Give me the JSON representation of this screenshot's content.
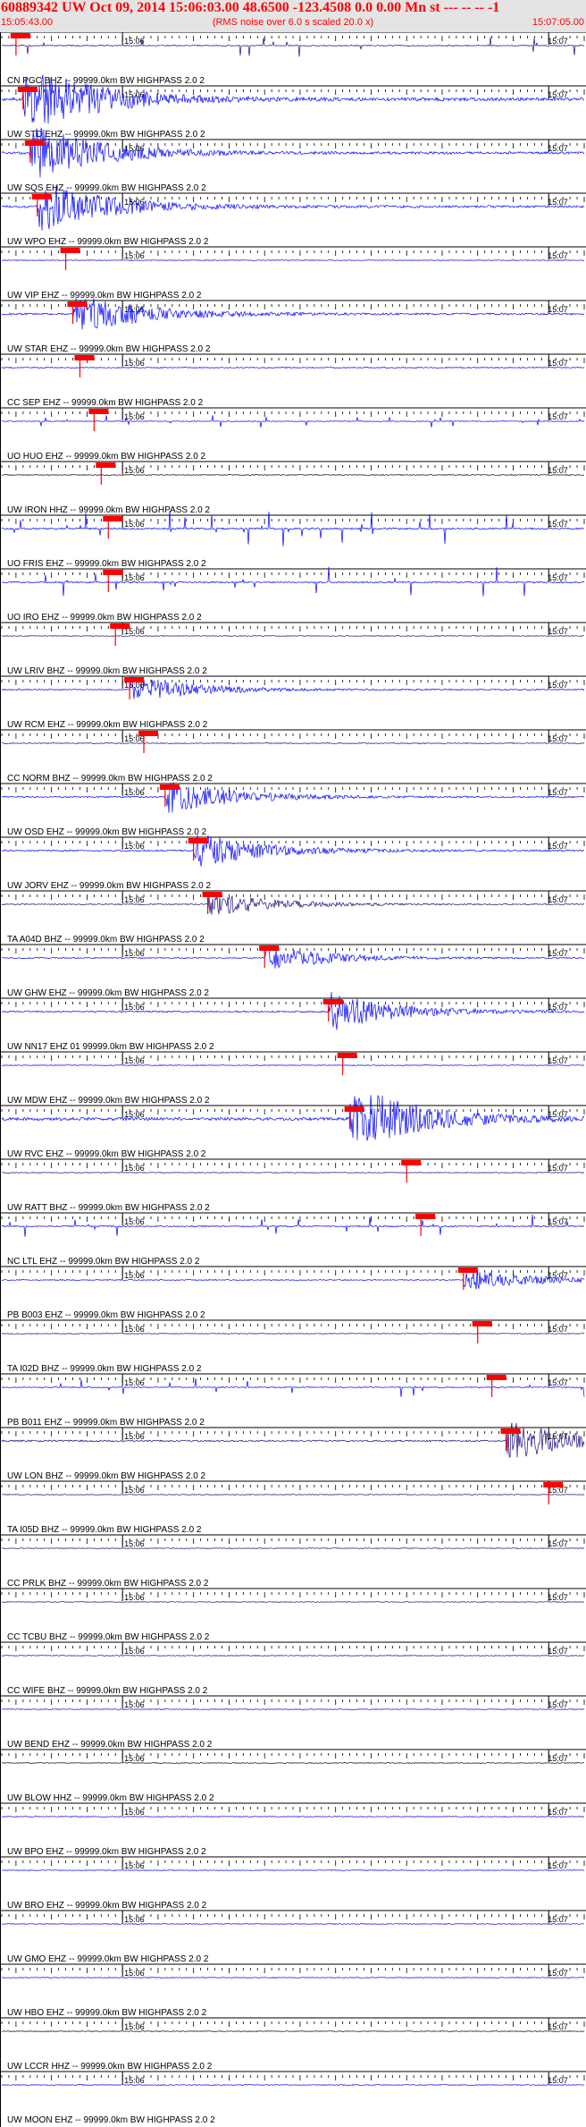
{
  "header": {
    "title": "60889342 UW Oct 09, 2014 15:06:03.00   48.6500 -123.4508  0.0 0.00 Mn st --- -- --   -1",
    "start_time": "15:05:43.00",
    "rms_note": "(RMS noise over 6.0 s scaled 20.0 x)",
    "end_time": "15:07:05.00"
  },
  "colors": {
    "header_text": "#ff0000",
    "header_bg": "#e4e4e4",
    "pick_marker": "#ff0000",
    "trace_blue": "#0000ff",
    "trace_navy": "#1a0a7a",
    "trace_black": "#000000",
    "label": "#000000"
  },
  "chart_data": {
    "type": "line",
    "time_range": [
      "15:05:43.00",
      "15:07:05.00"
    ],
    "tick_labels": [
      "15:06",
      "15:07"
    ],
    "tick_times": [
      "15:06:00",
      "15:07:00"
    ],
    "traces": [
      {
        "label": "CN PGC BHZ -- 99999.0km BW  HIGHPASS  2.0  2",
        "pick": "15:05:45",
        "amplitude": 1.0,
        "style": "spikes",
        "color": "navy"
      },
      {
        "label": "UW STD EHZ -- 99999.0km BW  HIGHPASS  2.0  2",
        "pick": "15:05:46",
        "amplitude": 3.2,
        "style": "burst",
        "color": "blue"
      },
      {
        "label": "UW SQS EHZ -- 99999.0km BW  HIGHPASS  2.0  2",
        "pick": "15:05:47",
        "amplitude": 2.4,
        "style": "burst",
        "color": "blue"
      },
      {
        "label": "UW WPO EHZ -- 99999.0km BW  HIGHPASS  2.0  2",
        "pick": "15:05:48",
        "amplitude": 2.2,
        "style": "burst",
        "color": "blue"
      },
      {
        "label": "UW VIP EHZ -- 99999.0km BW  HIGHPASS  2.0  2",
        "pick": "15:05:52",
        "amplitude": 0.6,
        "style": "noise",
        "color": "blue"
      },
      {
        "label": "UW STAR EHZ -- 99999.0km BW  HIGHPASS  2.0  2",
        "pick": "15:05:53",
        "amplitude": 1.8,
        "style": "burst",
        "color": "blue"
      },
      {
        "label": "CC SEP EHZ -- 99999.0km BW  HIGHPASS  2.0  2",
        "pick": "15:05:54",
        "amplitude": 0.9,
        "style": "noise",
        "color": "blue"
      },
      {
        "label": "UO HUO EHZ -- 99999.0km BW  HIGHPASS  2.0  2",
        "pick": "15:05:56",
        "amplitude": 0.6,
        "style": "spikes",
        "color": "blue"
      },
      {
        "label": "UW IRON HHZ -- 99999.0km BW  HIGHPASS  2.0  2",
        "pick": "15:05:57",
        "amplitude": 0.8,
        "style": "noise",
        "color": "black"
      },
      {
        "label": "UO FRIS EHZ -- 99999.0km BW  HIGHPASS  2.0  2",
        "pick": "15:05:58",
        "amplitude": 1.6,
        "style": "spikes",
        "color": "blue"
      },
      {
        "label": "UO IRO EHZ -- 99999.0km BW  HIGHPASS  2.0  2",
        "pick": "15:05:58",
        "amplitude": 1.4,
        "style": "spikes",
        "color": "blue"
      },
      {
        "label": "UW LRIV BHZ -- 99999.0km BW  HIGHPASS  2.0  2",
        "pick": "15:05:59",
        "amplitude": 0.4,
        "style": "noise",
        "color": "navy"
      },
      {
        "label": "UW RCM EHZ -- 99999.0km BW  HIGHPASS  2.0  2",
        "pick": "15:06:01",
        "amplitude": 1.1,
        "style": "burst",
        "color": "blue"
      },
      {
        "label": "CC NORM BHZ -- 99999.0km BW  HIGHPASS  2.0  2",
        "pick": "15:06:03",
        "amplitude": 0.9,
        "style": "noise",
        "color": "navy"
      },
      {
        "label": "UW OSD EHZ -- 99999.0km BW  HIGHPASS  2.0  2",
        "pick": "15:06:06",
        "amplitude": 1.4,
        "style": "burst",
        "color": "blue"
      },
      {
        "label": "UW JORV EHZ -- 99999.0km BW  HIGHPASS  2.0  2",
        "pick": "15:06:10",
        "amplitude": 1.5,
        "style": "burst",
        "color": "blue"
      },
      {
        "label": "TA A04D BHZ -- 99999.0km BW  HIGHPASS  2.0  2",
        "pick": "15:06:12",
        "amplitude": 1.0,
        "style": "burst",
        "color": "navy"
      },
      {
        "label": "UW GHW EHZ -- 99999.0km BW  HIGHPASS  2.0  2",
        "pick": "15:06:20",
        "amplitude": 1.0,
        "style": "burst",
        "color": "blue"
      },
      {
        "label": "UW NN17 EHZ 01 99999.0km BW  HIGHPASS  2.0  2",
        "pick": "15:06:29",
        "amplitude": 1.6,
        "style": "burst",
        "color": "blue"
      },
      {
        "label": "UW MDW EHZ -- 99999.0km BW  HIGHPASS  2.0  2",
        "pick": "15:06:31",
        "amplitude": 0.5,
        "style": "noise",
        "color": "blue"
      },
      {
        "label": "UW RVC EHZ -- 99999.0km BW  HIGHPASS  2.0  2",
        "pick": "15:06:32",
        "amplitude": 3.0,
        "style": "burst",
        "color": "blue"
      },
      {
        "label": "UW RATT BHZ -- 99999.0km BW  HIGHPASS  2.0  2",
        "pick": "15:06:40",
        "amplitude": 0.5,
        "style": "noise",
        "color": "navy"
      },
      {
        "label": "NC LTL EHZ -- 99999.0km BW  HIGHPASS  2.0  2",
        "pick": "15:06:42",
        "amplitude": 1.2,
        "style": "spikes",
        "color": "blue"
      },
      {
        "label": "PB B003 EHZ -- 99999.0km BW  HIGHPASS  2.0  2",
        "pick": "15:06:48",
        "amplitude": 0.9,
        "style": "burst",
        "color": "blue"
      },
      {
        "label": "TA I02D BHZ -- 99999.0km BW  HIGHPASS  2.0  2",
        "pick": "15:06:50",
        "amplitude": 0.5,
        "style": "noise",
        "color": "navy"
      },
      {
        "label": "PB B011 EHZ -- 99999.0km BW  HIGHPASS  2.0  2",
        "pick": "15:06:52",
        "amplitude": 0.9,
        "style": "spikes",
        "color": "blue"
      },
      {
        "label": "UW LON BHZ -- 99999.0km BW  HIGHPASS  2.0  2",
        "pick": "15:06:54",
        "amplitude": 1.7,
        "style": "burst",
        "color": "navy"
      },
      {
        "label": "TA I05D BHZ -- 99999.0km BW  HIGHPASS  2.0  2",
        "pick": "15:07:00",
        "amplitude": 0.6,
        "style": "noise",
        "color": "navy"
      },
      {
        "label": "CC PRLK BHZ -- 99999.0km BW  HIGHPASS  2.0  2",
        "pick": null,
        "amplitude": 0.2,
        "style": "noise",
        "color": "navy"
      },
      {
        "label": "CC TCBU BHZ -- 99999.0km BW  HIGHPASS  2.0  2",
        "pick": null,
        "amplitude": 0.2,
        "style": "noise",
        "color": "navy"
      },
      {
        "label": "CC WIFE BHZ -- 99999.0km BW  HIGHPASS  2.0  2",
        "pick": null,
        "amplitude": 0.2,
        "style": "noise",
        "color": "navy"
      },
      {
        "label": "UW BEND EHZ -- 99999.0km BW  HIGHPASS  2.0  2",
        "pick": null,
        "amplitude": 0.3,
        "style": "noise",
        "color": "blue"
      },
      {
        "label": "UW BLOW HHZ -- 99999.0km BW  HIGHPASS  2.0  2",
        "pick": null,
        "amplitude": 0.5,
        "style": "noise",
        "color": "black"
      },
      {
        "label": "UW BPO EHZ -- 99999.0km BW  HIGHPASS  2.0  2",
        "pick": null,
        "amplitude": 0.6,
        "style": "noise",
        "color": "blue"
      },
      {
        "label": "UW BRO EHZ -- 99999.0km BW  HIGHPASS  2.0  2",
        "pick": null,
        "amplitude": 0.4,
        "style": "noise",
        "color": "blue"
      },
      {
        "label": "UW GMO EHZ -- 99999.0km BW  HIGHPASS  2.0  2",
        "pick": null,
        "amplitude": 0.4,
        "style": "noise",
        "color": "blue"
      },
      {
        "label": "UW HBO EHZ -- 99999.0km BW  HIGHPASS  2.0  2",
        "pick": null,
        "amplitude": 0.2,
        "style": "noise",
        "color": "blue"
      },
      {
        "label": "UW LCCR HHZ -- 99999.0km BW  HIGHPASS  2.0  2",
        "pick": null,
        "amplitude": 0.4,
        "style": "noise",
        "color": "black"
      },
      {
        "label": "UW MOON EHZ -- 99999.0km BW  HIGHPASS  2.0  2",
        "pick": null,
        "amplitude": 0.5,
        "style": "noise",
        "color": "blue"
      }
    ]
  }
}
